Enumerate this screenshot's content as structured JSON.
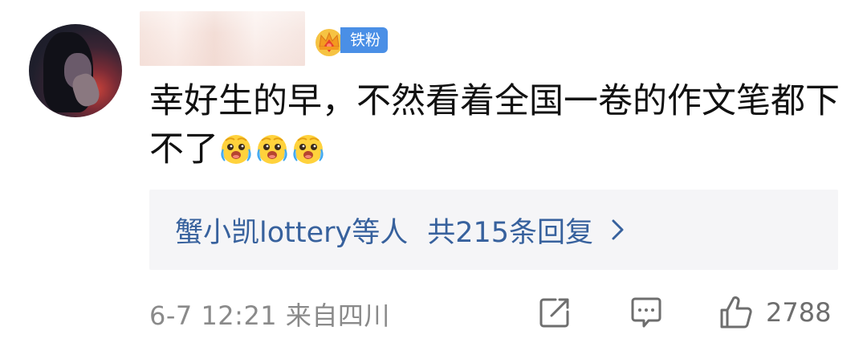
{
  "comment": {
    "avatar_icon": "user-avatar",
    "badge": {
      "icon": "crown-icon",
      "label": "铁粉",
      "color": "#4a8fe6"
    },
    "text": "幸好生的早，不然看着全国一卷的作文笔都下不了",
    "emojis": [
      "crying-laughing-emoji",
      "crying-laughing-emoji",
      "crying-laughing-emoji"
    ],
    "replies": {
      "who": "蟹小凯lottery等人",
      "count": "共215条回复",
      "icon": "chevron-right-icon",
      "color": "#37619d"
    },
    "footer": {
      "timestamp": "6-7 12:21 来自四川",
      "share_icon": "share-icon",
      "reply_icon": "comment-icon",
      "like_icon": "thumbs-up-icon",
      "like_count": "2788"
    }
  }
}
